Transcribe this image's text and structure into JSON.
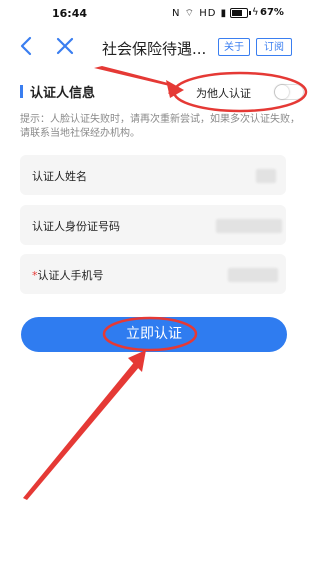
{
  "status_bar": {
    "time": "16:44",
    "indicators": "N ⌔ HD ▮",
    "battery_pct": "67%"
  },
  "nav": {
    "back_icon": "chevron-left-icon",
    "close_icon": "close-icon",
    "title": "社会保险待遇...",
    "about_label": "关于",
    "subscribe_label": "订阅"
  },
  "section": {
    "title": "认证人信息",
    "toggle_label": "为他人认证",
    "toggle_on": false
  },
  "hint": "提示：人脸认证失败时，请再次重新尝试，如果多次认证失败，请联系当地社保经办机构。",
  "fields": [
    {
      "label": "认证人姓名",
      "required": false
    },
    {
      "label": "认证人身份证号码",
      "required": false
    },
    {
      "label": "认证人手机号",
      "required": true,
      "required_mark": "*"
    }
  ],
  "submit_label": "立即认证",
  "colors": {
    "accent": "#2f7cf0",
    "annotation": "#e53935",
    "hint": "#8a8a8a"
  }
}
